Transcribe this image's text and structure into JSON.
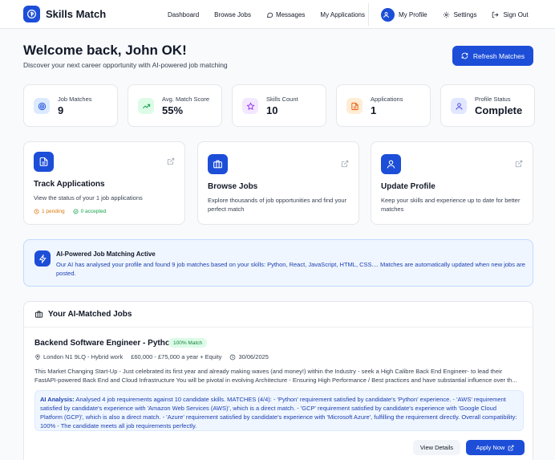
{
  "nav": {
    "brand": "Skills Match",
    "links": [
      {
        "label": "Dashboard",
        "icon": "none"
      },
      {
        "label": "Browse Jobs",
        "icon": "none"
      },
      {
        "label": "Messages",
        "icon": "message-icon"
      },
      {
        "label": "My Applications",
        "icon": "none"
      }
    ],
    "profile_label": "My Profile",
    "settings_label": "Settings",
    "signout_label": "Sign Out"
  },
  "hero": {
    "title": "Welcome back, John OK!",
    "subtitle": "Discover your next career opportunity with AI-powered job matching",
    "refresh_label": "Refresh Matches"
  },
  "stats": [
    {
      "label": "Job Matches",
      "value": "9",
      "icon": "target-icon",
      "color": "#dbeafe"
    },
    {
      "label": "Avg. Match Score",
      "value": "55%",
      "icon": "trend-up-icon",
      "color": "#dcfce7"
    },
    {
      "label": "Skills Count",
      "value": "10",
      "icon": "star-icon",
      "color": "#f3e8ff"
    },
    {
      "label": "Applications",
      "value": "1",
      "icon": "document-icon",
      "color": "#ffedd5"
    },
    {
      "label": "Profile Status",
      "value": "Complete",
      "icon": "user-icon",
      "color": "#e0e7ff"
    }
  ],
  "cards": [
    {
      "title": "Track Applications",
      "desc": "View the status of your 1 job applications",
      "pending": "1 pending",
      "accepted": "0 accepted"
    },
    {
      "title": "Browse Jobs",
      "desc": "Explore thousands of job opportunities and find your perfect match"
    },
    {
      "title": "Update Profile",
      "desc": "Keep your skills and experience up to date for better matches"
    }
  ],
  "banner": {
    "title": "AI-Powered Job Matching Active",
    "text": "Our AI has analysed your profile and found 9 job matches based on your skills: Python, React, JavaScript, HTML, CSS.... Matches are automatically updated when new jobs are posted."
  },
  "jobs": {
    "header": "Your AI-Matched Jobs",
    "items": [
      {
        "title": "Backend Software Engineer - Python",
        "match": "100% Match",
        "location": "London N1 9LQ - Hybrid work",
        "salary": "£60,000 - £75,000 a year + Equity",
        "date": "30/06/2025",
        "desc": "This Market Changing Start-Up - Just celebrated its first year and already making waves (and money!) within the Industry - seek a High Calibre Back End Engineer- to lead their FastAPI-powered Back End and Cloud Infrastructure You will be pivotal in evolving Architecture - Ensuring High Performance / Best practices and have substantial influence over th...",
        "analysis_label": "AI Analysis:",
        "analysis": "Analysed 4 job requirements against 10 candidate skills. MATCHES (4/4): - 'Python' requirement satisfied by candidate's 'Python' experience. - 'AWS' requirement satisfied by candidate's experience with 'Amazon Web Services (AWS)', which is a direct match. - 'GCP' requirement satisfied by candidate's experience with 'Google Cloud Platform (GCP)', which is also a direct match. - 'Azure' requirement satisfied by candidate's experience with 'Microsoft Azure', fulfilling the requirement directly. Overall compatibility: 100% - The candidate meets all job requirements perfectly.",
        "view_label": "View Details",
        "apply_label": "Apply Now"
      }
    ]
  },
  "colors": {
    "accent": "#1d4ed8",
    "success": "#15803d",
    "warning": "#d97706"
  }
}
